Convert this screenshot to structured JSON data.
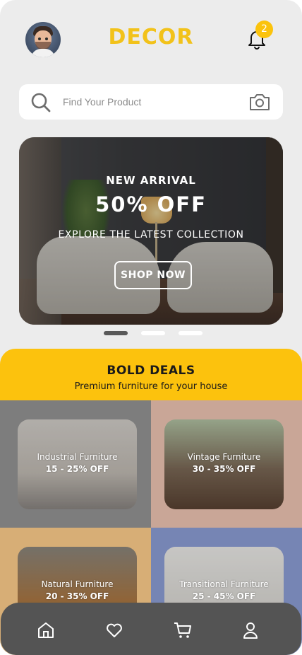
{
  "header": {
    "brand": "DECOR",
    "notification_count": "2",
    "brand_color": "#f2c21a",
    "badge_color": "#fbc30c"
  },
  "search": {
    "placeholder": "Find Your Product",
    "value": ""
  },
  "banner": {
    "kicker": "NEW ARRIVAL",
    "headline": "50% OFF",
    "subtext": "EXPLORE THE LATEST COLLECTION",
    "cta_label": "SHOP NOW"
  },
  "carousel": {
    "slide_count": 3,
    "active_index": 0
  },
  "deals": {
    "title": "BOLD DEALS",
    "subtitle": "Premium furniture for your house",
    "accent": "#fcc20d",
    "items": [
      {
        "name": "Industrial Furniture",
        "discount": "15 - 25% OFF",
        "tile_color": "#7d7d7d"
      },
      {
        "name": "Vintage Furniture",
        "discount": "30 - 35% OFF",
        "tile_color": "#c9a697"
      },
      {
        "name": "Natural Furniture",
        "discount": "20 - 35% OFF",
        "tile_color": "#d7ae76"
      },
      {
        "name": "Transitional Furniture",
        "discount": "25 - 45% OFF",
        "tile_color": "#7685b4"
      }
    ]
  },
  "bottom_nav": {
    "items": [
      "home-icon",
      "heart-icon",
      "cart-icon",
      "user-icon"
    ],
    "background": "#545454"
  }
}
